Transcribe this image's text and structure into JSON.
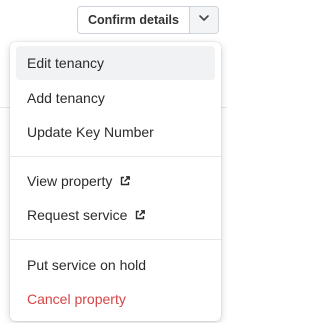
{
  "header": {
    "confirm_label": "Confirm details",
    "caret_icon": "chevron-down-icon"
  },
  "menu": {
    "group1": [
      {
        "label": "Edit tenancy",
        "state": "hover"
      },
      {
        "label": "Add tenancy"
      },
      {
        "label": "Update Key Number"
      }
    ],
    "group2": [
      {
        "label": "View property",
        "icon": "external-link-icon"
      },
      {
        "label": "Request service",
        "icon": "external-link-icon"
      }
    ],
    "group3": [
      {
        "label": "Put service on hold"
      },
      {
        "label": "Cancel property",
        "color": "#d64545"
      }
    ]
  },
  "colors": {
    "danger": "#d64545",
    "hover_bg": "#f1f2f4",
    "border": "#cfd3da"
  }
}
